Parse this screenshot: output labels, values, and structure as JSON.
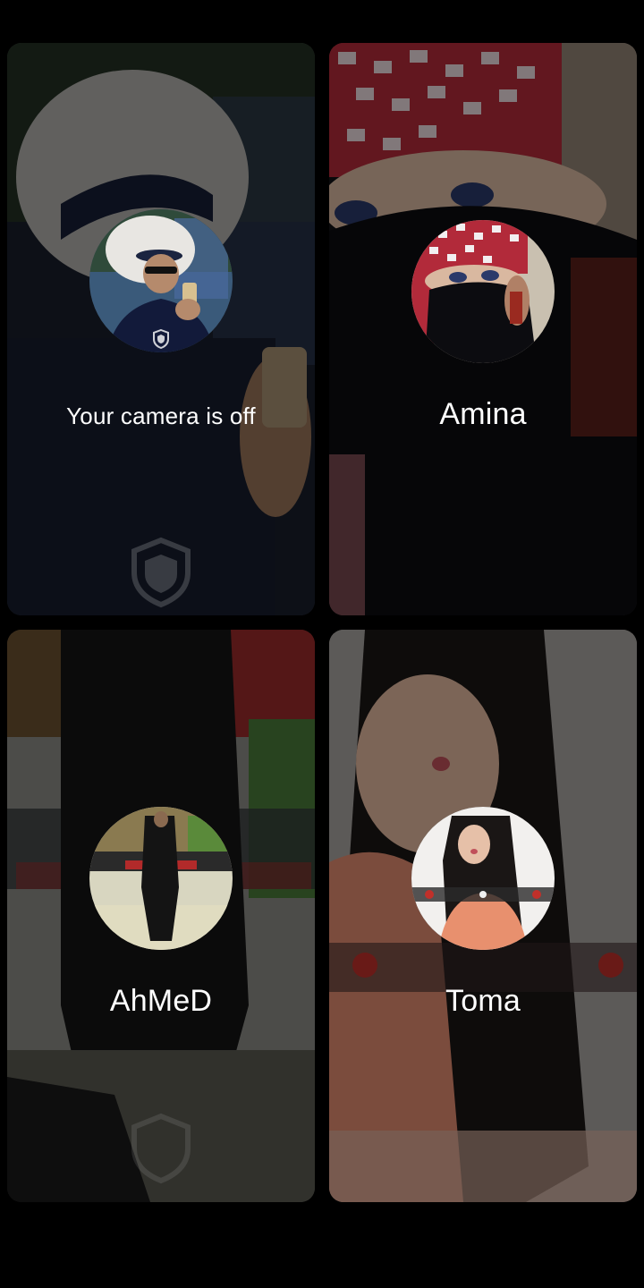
{
  "participants": [
    {
      "status_text": "Your camera is off",
      "kind": "self"
    },
    {
      "name": "Amina",
      "kind": "remote"
    },
    {
      "name": "AhMeD",
      "kind": "remote"
    },
    {
      "name": "Toma",
      "kind": "remote"
    }
  ],
  "colors": {
    "screen_background": "#000000",
    "label_text": "#ffffff"
  },
  "icons": [
    "shield-icon"
  ]
}
